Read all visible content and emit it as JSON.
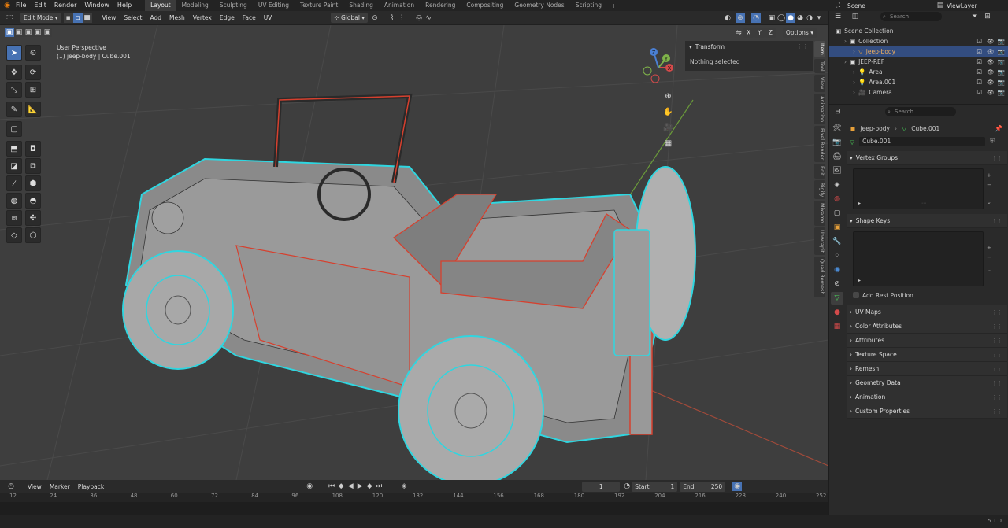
{
  "menu": [
    "File",
    "Edit",
    "Render",
    "Window",
    "Help"
  ],
  "workspaces": [
    {
      "label": "Layout",
      "active": true
    },
    {
      "label": "Modeling",
      "active": false
    },
    {
      "label": "Sculpting",
      "active": false
    },
    {
      "label": "UV Editing",
      "active": false
    },
    {
      "label": "Texture Paint",
      "active": false
    },
    {
      "label": "Shading",
      "active": false
    },
    {
      "label": "Animation",
      "active": false
    },
    {
      "label": "Rendering",
      "active": false
    },
    {
      "label": "Compositing",
      "active": false
    },
    {
      "label": "Geometry Nodes",
      "active": false
    },
    {
      "label": "Scripting",
      "active": false
    }
  ],
  "add_workspace": "+",
  "scene": "Scene",
  "view_layer": "ViewLayer",
  "viewport_header": {
    "mode": "Edit Mode",
    "menus": [
      "View",
      "Select",
      "Add",
      "Mesh",
      "Vertex",
      "Edge",
      "Face",
      "UV"
    ],
    "transform_orientation": "Global",
    "axes": [
      "X",
      "Y",
      "Z"
    ],
    "options": "Options"
  },
  "viewport_info": {
    "line1": "User Perspective",
    "line2": "(1) jeep-body | Cube.001"
  },
  "gizmo": {
    "x": "X",
    "y": "Y",
    "z": "Z"
  },
  "npanel": {
    "header": "Transform",
    "message": "Nothing selected",
    "tabs": [
      {
        "label": "Item",
        "active": true
      },
      {
        "label": "Tool",
        "active": false
      },
      {
        "label": "View",
        "active": false
      },
      {
        "label": "Animation",
        "active": false
      },
      {
        "label": "Pixel Render",
        "active": false
      },
      {
        "label": "Edit",
        "active": false
      },
      {
        "label": "Rigify",
        "active": false
      },
      {
        "label": "Mixamo",
        "active": false
      },
      {
        "label": "Unwrapit",
        "active": false
      },
      {
        "label": "Quad Remesh",
        "active": false
      }
    ]
  },
  "outliner": {
    "search_placeholder": "Search",
    "rows": [
      {
        "label": "Scene Collection",
        "indent": 0,
        "selected": false
      },
      {
        "label": "Collection",
        "indent": 1,
        "selected": false
      },
      {
        "label": "jeep-body",
        "indent": 2,
        "selected": true
      },
      {
        "label": "JEEP-REF",
        "indent": 1,
        "selected": false
      },
      {
        "label": "Area",
        "indent": 2,
        "selected": false
      },
      {
        "label": "Area.001",
        "indent": 2,
        "selected": false
      },
      {
        "label": "Camera",
        "indent": 2,
        "selected": false
      }
    ]
  },
  "properties": {
    "search_placeholder": "Search",
    "breadcrumb_object": "jeep-body",
    "breadcrumb_mesh": "Cube.001",
    "datablock": "Cube.001",
    "vertex_groups": "Vertex Groups",
    "shape_keys": "Shape Keys",
    "add_rest_position": "Add Rest Position",
    "collapsed_panels": [
      "UV Maps",
      "Color Attributes",
      "Attributes",
      "Texture Space",
      "Remesh",
      "Geometry Data",
      "Animation",
      "Custom Properties"
    ]
  },
  "timeline": {
    "menus": [
      "View",
      "Marker",
      "Playback"
    ],
    "current_frame": "1",
    "start_label": "Start",
    "start": "1",
    "end_label": "End",
    "end": "250",
    "ruler": [
      "12",
      "24",
      "36",
      "48",
      "60",
      "72",
      "84",
      "96",
      "108",
      "120",
      "132",
      "144",
      "156",
      "168",
      "180",
      "192",
      "204",
      "216",
      "228",
      "240",
      "252"
    ]
  },
  "version": "5.1.0",
  "colors": {
    "accent": "#4772b3",
    "selection_cyan": "#2fd6e0",
    "seam_red": "#d6402e",
    "viewport_bg": "#3e3e3e"
  }
}
